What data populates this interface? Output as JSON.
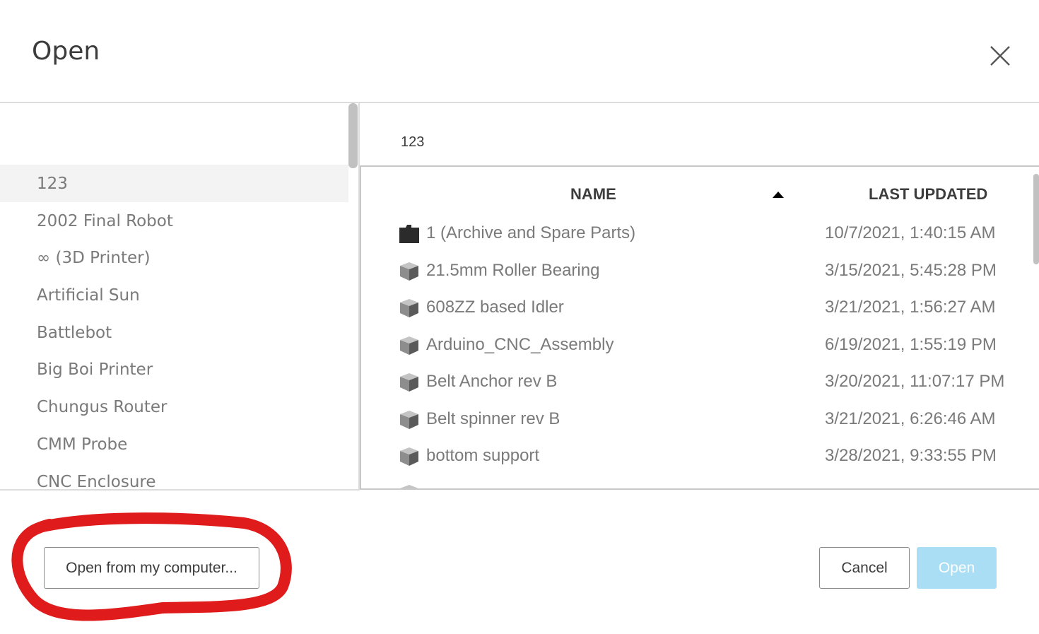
{
  "dialog": {
    "title": "Open"
  },
  "sidebar": {
    "items": [
      {
        "label": "123",
        "selected": true
      },
      {
        "label": "2002 Final Robot"
      },
      {
        "label": "∞ (3D Printer)"
      },
      {
        "label": "Artificial Sun"
      },
      {
        "label": "Battlebot"
      },
      {
        "label": "Big Boi Printer"
      },
      {
        "label": "Chungus Router"
      },
      {
        "label": "CMM Probe"
      },
      {
        "label": "CNC Enclosure"
      }
    ]
  },
  "breadcrumb": "123",
  "table": {
    "columns": {
      "name": "NAME",
      "updated": "LAST UPDATED"
    },
    "sort": "name-ascending",
    "rows": [
      {
        "icon": "folder-icon",
        "name": "1 (Archive and Spare Parts)",
        "date": "10/7/2021, 1:40:15 AM"
      },
      {
        "icon": "design-cube-icon",
        "name": "21.5mm Roller Bearing",
        "date": "3/15/2021, 5:45:28 PM"
      },
      {
        "icon": "design-cube-icon",
        "name": "608ZZ based Idler",
        "date": "3/21/2021, 1:56:27 AM"
      },
      {
        "icon": "design-cube-icon",
        "name": "Arduino_CNC_Assembly",
        "date": "6/19/2021, 1:55:19 PM"
      },
      {
        "icon": "design-cube-icon",
        "name": "Belt Anchor rev B",
        "date": "3/20/2021, 11:07:17 PM"
      },
      {
        "icon": "design-cube-icon",
        "name": "Belt spinner rev B",
        "date": "3/21/2021, 6:26:46 AM"
      },
      {
        "icon": "design-cube-icon",
        "name": "bottom support",
        "date": "3/28/2021, 9:33:55 PM"
      }
    ]
  },
  "footer": {
    "local_label": "Open from my computer...",
    "cancel_label": "Cancel",
    "open_label": "Open"
  },
  "colors": {
    "open_button_disabled": "#a9def4",
    "annotation_circle": "#e01b1b",
    "selected_row_bg": "#f3f3f3"
  }
}
